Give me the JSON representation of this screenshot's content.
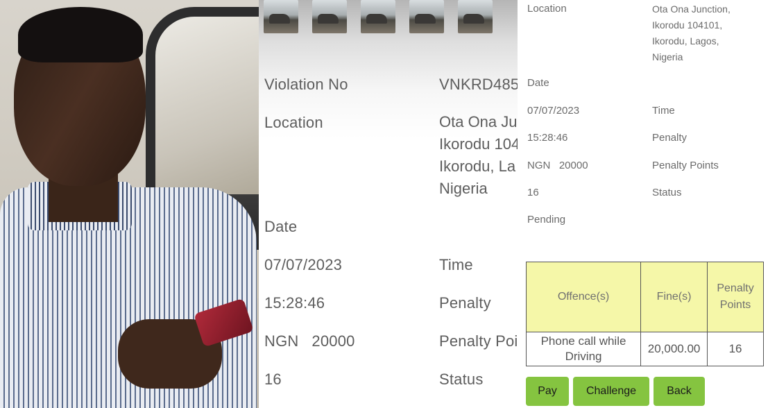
{
  "zoomed_view": {
    "fields": [
      {
        "label": "Violation No",
        "value": "VNKRD485"
      },
      {
        "label": "Location",
        "value_lines": [
          "Ota Ona Ju",
          "Ikorodu 104",
          "Ikorodu, La",
          "Nigeria"
        ]
      },
      {
        "label": "Date",
        "value": "07/07/2023"
      },
      {
        "label": "Time",
        "value": "15:28:46"
      },
      {
        "label": "Penalty",
        "value": "NGN   20000"
      },
      {
        "label": "Penalty Poi",
        "value": "16"
      },
      {
        "label": "Status",
        "value": ""
      }
    ]
  },
  "app_view": {
    "location": {
      "label": "Location",
      "value_lines": [
        "Ota Ona Junction,",
        "Ikorodu 104101,",
        "Ikorodu, Lagos,",
        "Nigeria"
      ]
    },
    "date": {
      "label": "Date",
      "value": "07/07/2023"
    },
    "time": {
      "label": "Time",
      "value": "15:28:46"
    },
    "penalty": {
      "label": "Penalty",
      "value": "NGN   20000"
    },
    "penalty_points": {
      "label": "Penalty Points",
      "value": "16"
    },
    "status": {
      "label": "Status",
      "value": "Pending"
    },
    "table": {
      "headers": [
        "Offence(s)",
        "Fine(s)",
        "Penalty Points"
      ],
      "rows": [
        {
          "offence": "Phone call while Driving",
          "fine": "20,000.00",
          "points": "16"
        }
      ]
    },
    "buttons": {
      "pay": "Pay",
      "challenge": "Challenge",
      "back": "Back"
    }
  },
  "colors": {
    "table_header_bg": "#f5f7a8",
    "button_bg": "#85c440",
    "label_text": "#6b6b6b"
  }
}
